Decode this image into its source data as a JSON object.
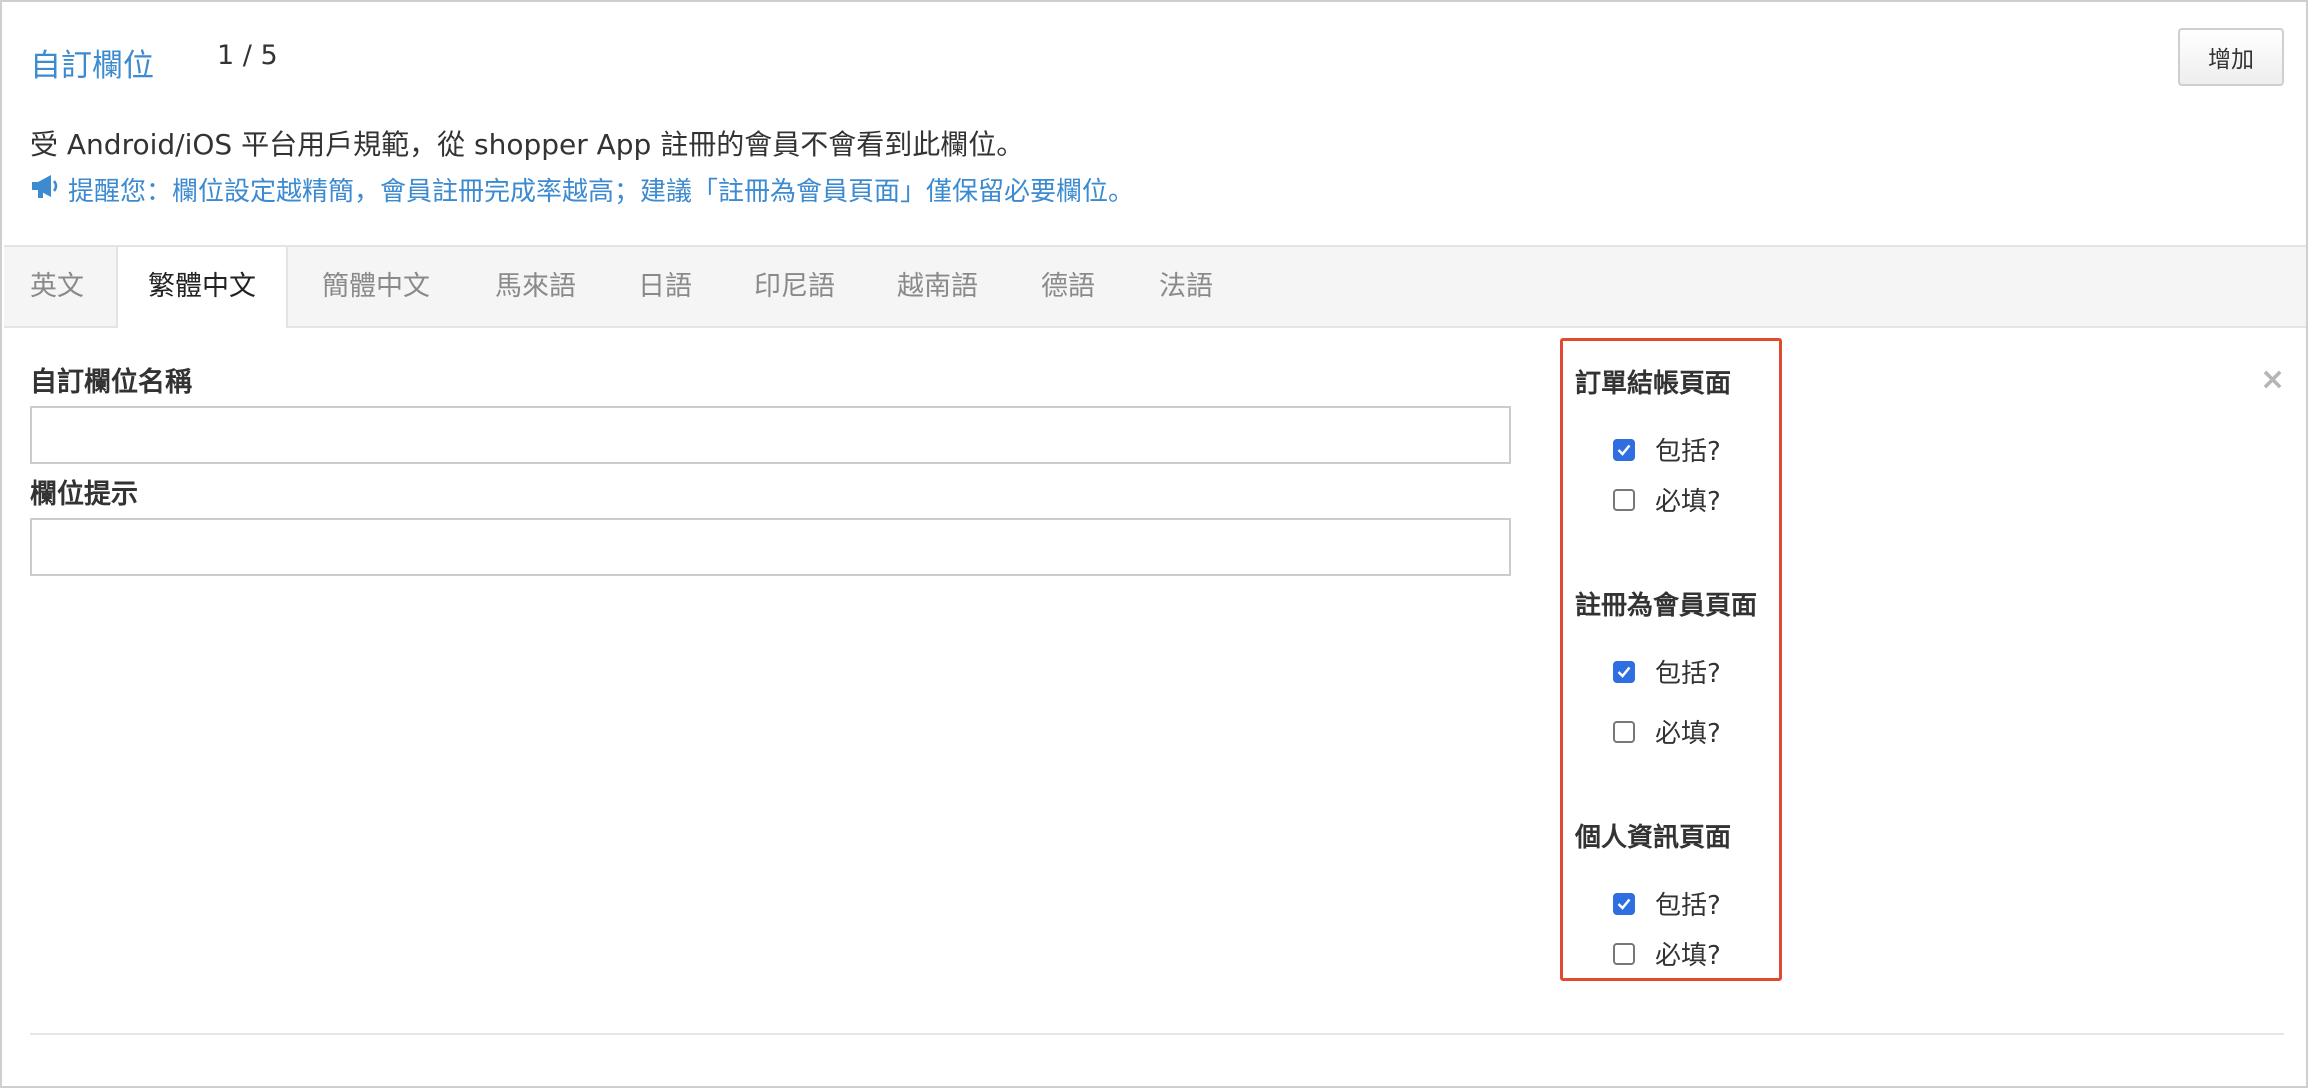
{
  "header": {
    "title": "自訂欄位",
    "counter": "1 / 5",
    "add_label": "增加"
  },
  "notice": {
    "description": "受 Android/iOS 平台用戶規範，從 shopper App 註冊的會員不會看到此欄位。",
    "reminder": "提醒您：欄位設定越精簡，會員註冊完成率越高；建議「註冊為會員頁面」僅保留必要欄位。",
    "reminder_icon": "megaphone-icon"
  },
  "tabs": [
    {
      "label": "英文",
      "active": false
    },
    {
      "label": "繁體中文",
      "active": true
    },
    {
      "label": "簡體中文",
      "active": false
    },
    {
      "label": "馬來語",
      "active": false
    },
    {
      "label": "日語",
      "active": false
    },
    {
      "label": "印尼語",
      "active": false
    },
    {
      "label": "越南語",
      "active": false
    },
    {
      "label": "德語",
      "active": false
    },
    {
      "label": "法語",
      "active": false
    }
  ],
  "form": {
    "name_label": "自訂欄位名稱",
    "name_value": "",
    "hint_label": "欄位提示",
    "hint_value": ""
  },
  "sections": [
    {
      "title": "訂單結帳頁面",
      "include_label": "包括?",
      "include": true,
      "required_label": "必填?",
      "required": false
    },
    {
      "title": "註冊為會員頁面",
      "include_label": "包括?",
      "include": true,
      "required_label": "必填?",
      "required": false
    },
    {
      "title": "個人資訊頁面",
      "include_label": "包括?",
      "include": true,
      "required_label": "必填?",
      "required": false
    }
  ],
  "close_label": "×",
  "colors": {
    "link": "#3c8ad0",
    "highlight_border": "#e24a2f",
    "checkbox_checked": "#2f6ee0"
  }
}
